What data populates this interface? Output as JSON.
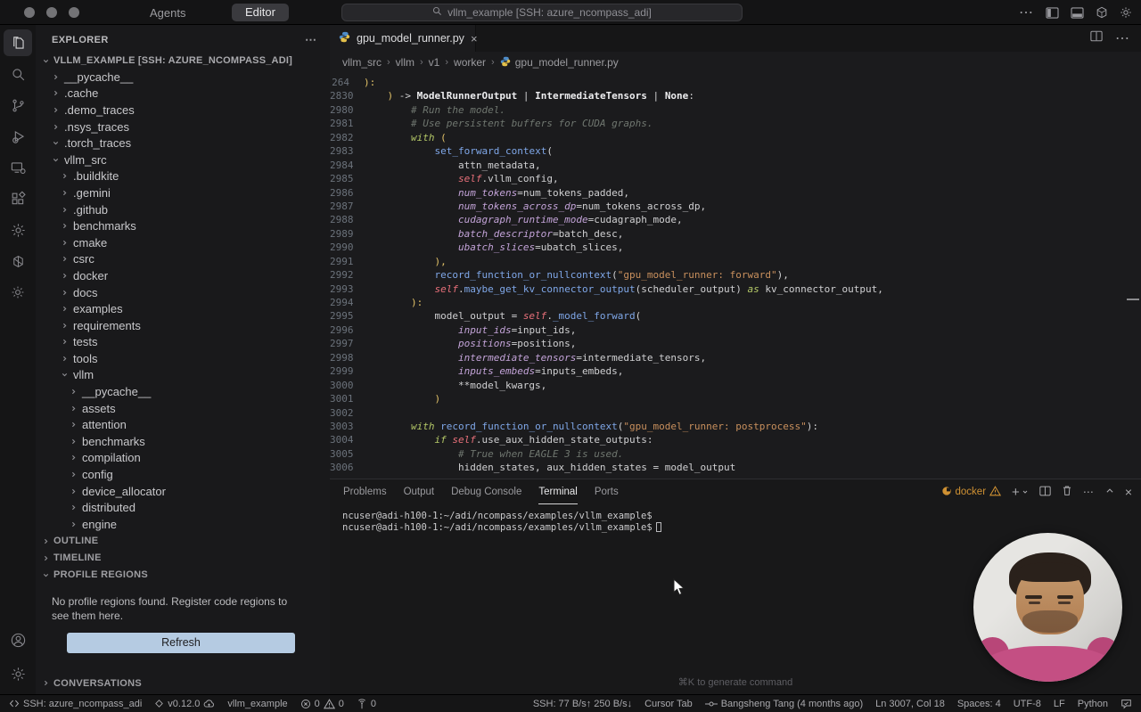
{
  "titlebar": {
    "agents": "Agents",
    "editor": "Editor",
    "search": "vllm_example [SSH: azure_ncompass_adi]"
  },
  "sidebar": {
    "explorer_title": "EXPLORER",
    "root": "VLLM_EXAMPLE [SSH: AZURE_NCOMPASS_ADI]",
    "tree": [
      {
        "label": "__pycache__",
        "d": 1,
        "c": ">"
      },
      {
        "label": ".cache",
        "d": 1,
        "c": ">"
      },
      {
        "label": ".demo_traces",
        "d": 1,
        "c": ">"
      },
      {
        "label": ".nsys_traces",
        "d": 1,
        "c": ">"
      },
      {
        "label": ".torch_traces",
        "d": 1,
        "c": "v"
      },
      {
        "label": "vllm_src",
        "d": 1,
        "c": "v"
      },
      {
        "label": ".buildkite",
        "d": 2,
        "c": ">"
      },
      {
        "label": ".gemini",
        "d": 2,
        "c": ">"
      },
      {
        "label": ".github",
        "d": 2,
        "c": ">"
      },
      {
        "label": "benchmarks",
        "d": 2,
        "c": ">"
      },
      {
        "label": "cmake",
        "d": 2,
        "c": ">"
      },
      {
        "label": "csrc",
        "d": 2,
        "c": ">"
      },
      {
        "label": "docker",
        "d": 2,
        "c": ">"
      },
      {
        "label": "docs",
        "d": 2,
        "c": ">"
      },
      {
        "label": "examples",
        "d": 2,
        "c": ">"
      },
      {
        "label": "requirements",
        "d": 2,
        "c": ">"
      },
      {
        "label": "tests",
        "d": 2,
        "c": ">"
      },
      {
        "label": "tools",
        "d": 2,
        "c": ">"
      },
      {
        "label": "vllm",
        "d": 2,
        "c": "v"
      },
      {
        "label": "__pycache__",
        "d": 3,
        "c": ">"
      },
      {
        "label": "assets",
        "d": 3,
        "c": ">"
      },
      {
        "label": "attention",
        "d": 3,
        "c": ">"
      },
      {
        "label": "benchmarks",
        "d": 3,
        "c": ">"
      },
      {
        "label": "compilation",
        "d": 3,
        "c": ">"
      },
      {
        "label": "config",
        "d": 3,
        "c": ">"
      },
      {
        "label": "device_allocator",
        "d": 3,
        "c": ">"
      },
      {
        "label": "distributed",
        "d": 3,
        "c": ">"
      },
      {
        "label": "engine",
        "d": 3,
        "c": ">"
      }
    ],
    "sections": {
      "outline": "OUTLINE",
      "timeline": "TIMELINE",
      "profile_regions": "PROFILE REGIONS",
      "conversations": "CONVERSATIONS"
    },
    "profile_message": "No profile regions found. Register code regions to see them here.",
    "refresh_label": "Refresh"
  },
  "editor": {
    "tab": "gpu_model_runner.py",
    "breadcrumbs": [
      "vllm_src",
      "vllm",
      "v1",
      "worker",
      "gpu_model_runner.py"
    ],
    "code_lines": [
      {
        "n": "264",
        "t": [
          [
            "y",
            "):"
          ]
        ]
      },
      {
        "n": "2830",
        "t": [
          [
            "t",
            "    "
          ],
          [
            "y",
            ") "
          ],
          [
            "o",
            "-> "
          ],
          [
            "b",
            "ModelRunnerOutput"
          ],
          [
            "o",
            " | "
          ],
          [
            "b",
            "IntermediateTensors"
          ],
          [
            "o",
            " | "
          ],
          [
            "b",
            "None"
          ],
          [
            "o",
            ":"
          ]
        ]
      },
      {
        "n": "2980",
        "t": [
          [
            "c",
            "        # Run the model."
          ]
        ]
      },
      {
        "n": "2981",
        "t": [
          [
            "c",
            "        # Use persistent buffers for CUDA graphs."
          ]
        ]
      },
      {
        "n": "2982",
        "t": [
          [
            "t",
            "        "
          ],
          [
            "k",
            "with"
          ],
          [
            "t",
            " "
          ],
          [
            "y",
            "("
          ]
        ]
      },
      {
        "n": "2983",
        "t": [
          [
            "t",
            "            "
          ],
          [
            "f",
            "set_forward_context"
          ],
          [
            "o",
            "("
          ]
        ]
      },
      {
        "n": "2984",
        "t": [
          [
            "t",
            "                attn_metadata,"
          ]
        ]
      },
      {
        "n": "2985",
        "t": [
          [
            "t",
            "                "
          ],
          [
            "se",
            "self"
          ],
          [
            "o",
            "."
          ],
          [
            "t",
            "vllm_config,"
          ]
        ]
      },
      {
        "n": "2986",
        "t": [
          [
            "t",
            "                "
          ],
          [
            "a",
            "num_tokens"
          ],
          [
            "o",
            "="
          ],
          [
            "t",
            "num_tokens_padded,"
          ]
        ]
      },
      {
        "n": "2987",
        "t": [
          [
            "t",
            "                "
          ],
          [
            "a",
            "num_tokens_across_dp"
          ],
          [
            "o",
            "="
          ],
          [
            "t",
            "num_tokens_across_dp,"
          ]
        ]
      },
      {
        "n": "2988",
        "t": [
          [
            "t",
            "                "
          ],
          [
            "a",
            "cudagraph_runtime_mode"
          ],
          [
            "o",
            "="
          ],
          [
            "t",
            "cudagraph_mode,"
          ]
        ]
      },
      {
        "n": "2989",
        "t": [
          [
            "t",
            "                "
          ],
          [
            "a",
            "batch_descriptor"
          ],
          [
            "o",
            "="
          ],
          [
            "t",
            "batch_desc,"
          ]
        ]
      },
      {
        "n": "2990",
        "t": [
          [
            "t",
            "                "
          ],
          [
            "a",
            "ubatch_slices"
          ],
          [
            "o",
            "="
          ],
          [
            "t",
            "ubatch_slices,"
          ]
        ]
      },
      {
        "n": "2991",
        "t": [
          [
            "t",
            "            "
          ],
          [
            "y",
            "),"
          ]
        ]
      },
      {
        "n": "2992",
        "t": [
          [
            "t",
            "            "
          ],
          [
            "f",
            "record_function_or_nullcontext"
          ],
          [
            "o",
            "("
          ],
          [
            "s",
            "\"gpu_model_runner: forward\""
          ],
          [
            "o",
            "),"
          ]
        ]
      },
      {
        "n": "2993",
        "t": [
          [
            "t",
            "            "
          ],
          [
            "se",
            "self"
          ],
          [
            "o",
            "."
          ],
          [
            "f",
            "maybe_get_kv_connector_output"
          ],
          [
            "o",
            "("
          ],
          [
            "t",
            "scheduler_output"
          ],
          [
            "o",
            ") "
          ],
          [
            "k",
            "as"
          ],
          [
            "t",
            " kv_connector_output,"
          ]
        ]
      },
      {
        "n": "2994",
        "t": [
          [
            "t",
            "        "
          ],
          [
            "y",
            "):"
          ]
        ]
      },
      {
        "n": "2995",
        "t": [
          [
            "t",
            "            model_output = "
          ],
          [
            "se",
            "self"
          ],
          [
            "o",
            "."
          ],
          [
            "f",
            "_model_forward"
          ],
          [
            "o",
            "("
          ]
        ]
      },
      {
        "n": "2996",
        "t": [
          [
            "t",
            "                "
          ],
          [
            "a",
            "input_ids"
          ],
          [
            "o",
            "="
          ],
          [
            "t",
            "input_ids,"
          ]
        ]
      },
      {
        "n": "2997",
        "t": [
          [
            "t",
            "                "
          ],
          [
            "a",
            "positions"
          ],
          [
            "o",
            "="
          ],
          [
            "t",
            "positions,"
          ]
        ]
      },
      {
        "n": "2998",
        "t": [
          [
            "t",
            "                "
          ],
          [
            "a",
            "intermediate_tensors"
          ],
          [
            "o",
            "="
          ],
          [
            "t",
            "intermediate_tensors,"
          ]
        ]
      },
      {
        "n": "2999",
        "t": [
          [
            "t",
            "                "
          ],
          [
            "a",
            "inputs_embeds"
          ],
          [
            "o",
            "="
          ],
          [
            "t",
            "inputs_embeds,"
          ]
        ]
      },
      {
        "n": "3000",
        "t": [
          [
            "t",
            "                **model_kwargs,"
          ]
        ]
      },
      {
        "n": "3001",
        "t": [
          [
            "t",
            "            "
          ],
          [
            "y",
            ")"
          ]
        ]
      },
      {
        "n": "3002",
        "t": []
      },
      {
        "n": "3003",
        "t": [
          [
            "t",
            "        "
          ],
          [
            "k",
            "with"
          ],
          [
            "t",
            " "
          ],
          [
            "f",
            "record_function_or_nullcontext"
          ],
          [
            "o",
            "("
          ],
          [
            "s",
            "\"gpu_model_runner: postprocess\""
          ],
          [
            "o",
            "):"
          ]
        ]
      },
      {
        "n": "3004",
        "t": [
          [
            "t",
            "            "
          ],
          [
            "k",
            "if"
          ],
          [
            "t",
            " "
          ],
          [
            "se",
            "self"
          ],
          [
            "o",
            "."
          ],
          [
            "t",
            "use_aux_hidden_state_outputs:"
          ]
        ]
      },
      {
        "n": "3005",
        "t": [
          [
            "c",
            "                # True when EAGLE 3 is used."
          ]
        ]
      },
      {
        "n": "3006",
        "t": [
          [
            "t",
            "                hidden_states, aux_hidden_states = model_output"
          ]
        ]
      }
    ]
  },
  "panel": {
    "tabs": [
      "Problems",
      "Output",
      "Debug Console",
      "Terminal",
      "Ports"
    ],
    "active_tab": "Terminal",
    "docker_label": "docker",
    "terminal_lines": [
      "ncuser@adi-h100-1:~/adi/ncompass/examples/vllm_example$",
      "ncuser@adi-h100-1:~/adi/ncompass/examples/vllm_example$"
    ],
    "hint": "⌘K to generate command"
  },
  "status_bar": {
    "left": [
      {
        "name": "remote-indicator",
        "icon": "remote",
        "text": "SSH: azure_ncompass_adi"
      },
      {
        "name": "version-badge",
        "icon": "tag",
        "text": "v0.12.0",
        "icon2": "cloud"
      },
      {
        "name": "branch-name",
        "text": "vllm_example"
      },
      {
        "name": "problems-badge",
        "icon": "error",
        "text": "0",
        "icon2": "warn",
        "text2": "0"
      },
      {
        "name": "port-forward-badge",
        "icon": "tower",
        "text": "0"
      }
    ],
    "right": [
      {
        "name": "ssh-throughput",
        "text": "SSH: 77 B/s↑ 250 B/s↓"
      },
      {
        "name": "cursor-tab",
        "text": "Cursor Tab"
      },
      {
        "name": "blame-info",
        "icon": "commit",
        "text": "Bangsheng Tang (4 months ago)"
      },
      {
        "name": "cursor-position",
        "text": "Ln 3007, Col 18"
      },
      {
        "name": "indentation",
        "text": "Spaces: 4"
      },
      {
        "name": "encoding",
        "text": "UTF-8"
      },
      {
        "name": "eol",
        "text": "LF"
      },
      {
        "name": "language-mode",
        "text": "Python"
      },
      {
        "name": "feedback",
        "icon": "feedback",
        "text": ""
      }
    ]
  }
}
